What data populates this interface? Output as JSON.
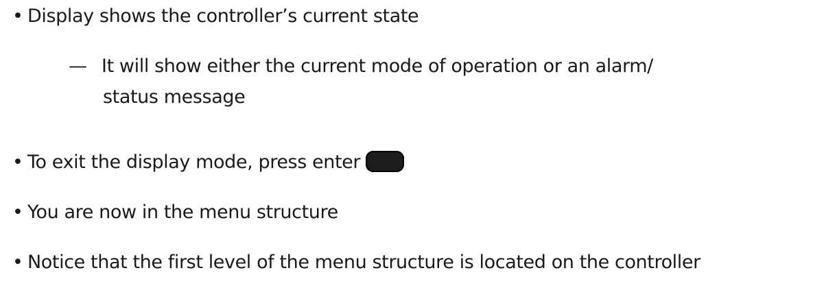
{
  "bullets": {
    "display_state": "Display shows the controller’s current state",
    "sub_dash": "—",
    "sub_line1": "It will show either the current mode of operation or an alarm/",
    "sub_line2": "status message",
    "exit_display": "To exit the display mode, press enter",
    "menu_structure": "You are now in the menu structure",
    "first_level": "Notice that the first level of the menu structure is located on the controller"
  },
  "icons": {
    "bullet": "•",
    "enter_key": "enter-key-icon"
  },
  "colors": {
    "text": "#1a1a1a",
    "enter_key": "#1c1c1c"
  }
}
